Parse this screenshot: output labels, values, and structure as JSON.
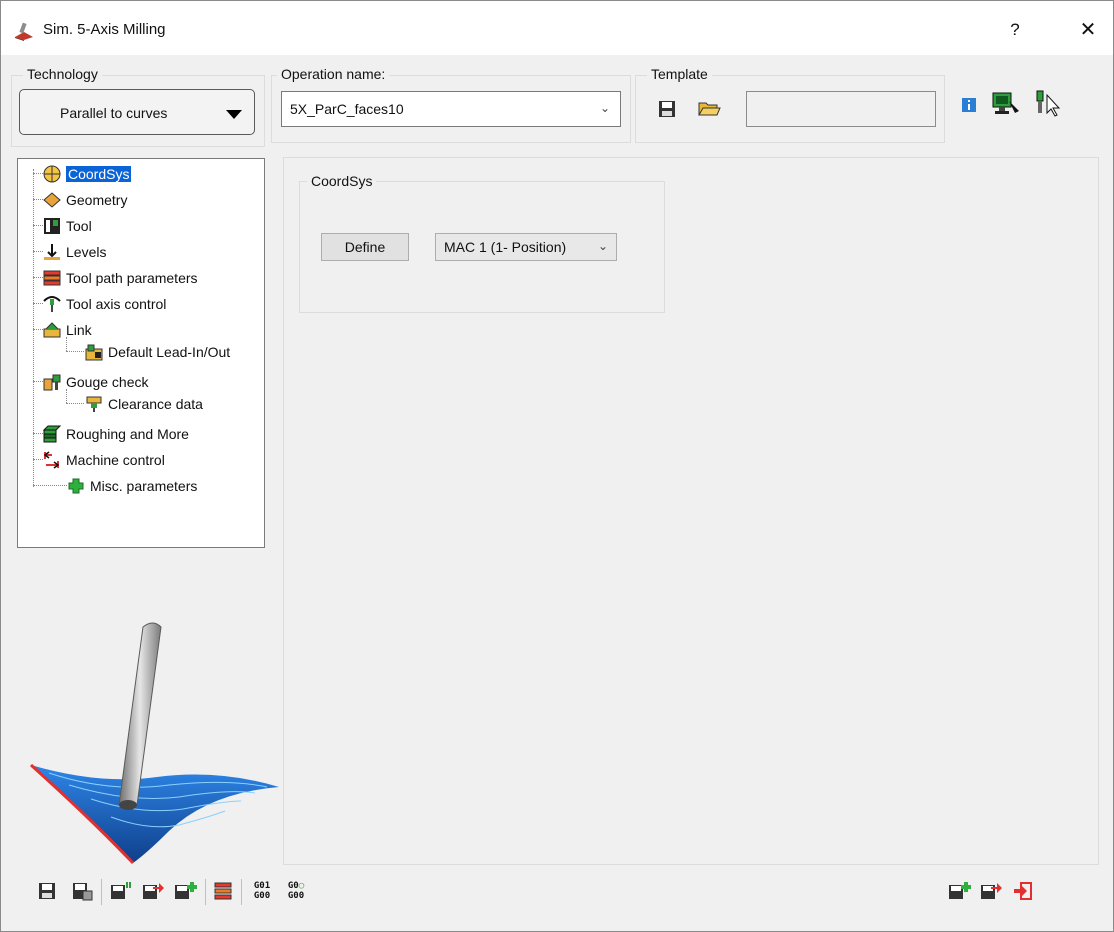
{
  "window": {
    "title": "Sim. 5-Axis Milling",
    "help_label": "?",
    "close_label": "✕"
  },
  "technology": {
    "group_label": "Technology",
    "selected": "Parallel to curves"
  },
  "operation": {
    "group_label": "Operation name:",
    "value": "5X_ParC_faces10"
  },
  "template": {
    "group_label": "Template",
    "value": ""
  },
  "tree": {
    "items": [
      {
        "label": "CoordSys",
        "icon": "coordsys-icon",
        "selected": true
      },
      {
        "label": "Geometry",
        "icon": "geometry-icon"
      },
      {
        "label": "Tool",
        "icon": "tool-icon"
      },
      {
        "label": "Levels",
        "icon": "levels-icon"
      },
      {
        "label": "Tool path parameters",
        "icon": "tool-path-icon"
      },
      {
        "label": "Tool axis control",
        "icon": "tool-axis-icon"
      },
      {
        "label": "Link",
        "icon": "link-icon"
      },
      {
        "label": "Default Lead-In/Out",
        "icon": "lead-in-out-icon"
      },
      {
        "label": "Gouge check",
        "icon": "gouge-check-icon"
      },
      {
        "label": "Clearance data",
        "icon": "clearance-icon"
      },
      {
        "label": "Roughing and More",
        "icon": "roughing-icon"
      },
      {
        "label": "Machine control",
        "icon": "machine-control-icon"
      },
      {
        "label": "Misc. parameters",
        "icon": "misc-parameters-icon"
      }
    ]
  },
  "coordsys": {
    "group_label": "CoordSys",
    "define_label": "Define",
    "mac_value": "MAC 1 (1- Position)"
  },
  "toolbar": {
    "g01": "G01",
    "g00": "G00",
    "g0": "G0"
  },
  "colors": {
    "selection": "#0a64d6",
    "surface_blue": "#1f6fd6",
    "edge_red": "#e23030"
  }
}
